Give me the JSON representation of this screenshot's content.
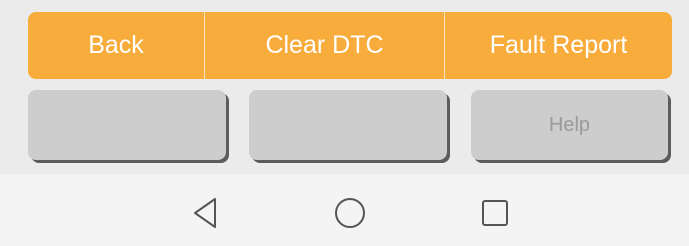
{
  "top_bar": {
    "back_label": "Back",
    "clear_dtc_label": "Clear DTC",
    "fault_report_label": "Fault Report",
    "color": "#f8ac3c"
  },
  "secondary_buttons": {
    "button_1_label": "",
    "button_2_label": "",
    "help_label": "Help"
  },
  "system_nav": {
    "back_icon": "triangle-back-icon",
    "home_icon": "circle-home-icon",
    "recents_icon": "square-recents-icon"
  }
}
